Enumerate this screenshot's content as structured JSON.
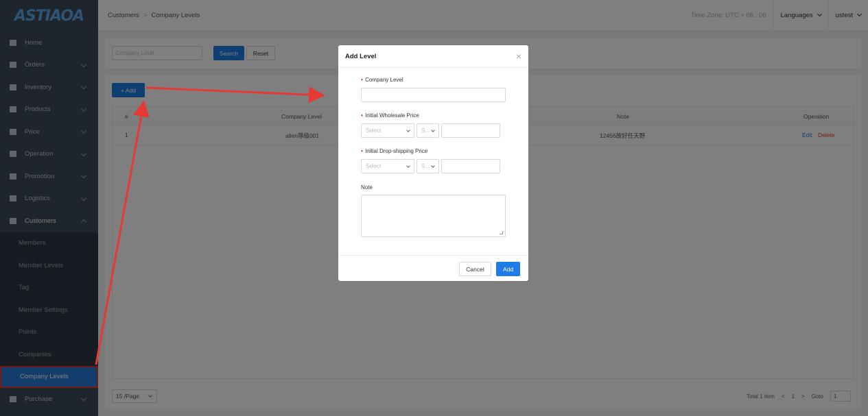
{
  "sidebar": {
    "logo": "ASTIAOA",
    "items": [
      {
        "label": "Home",
        "icon": "home-icon"
      },
      {
        "label": "Orders",
        "icon": "orders-icon"
      },
      {
        "label": "Inventory",
        "icon": "inventory-icon"
      },
      {
        "label": "Products",
        "icon": "products-icon"
      },
      {
        "label": "Price",
        "icon": "price-icon"
      },
      {
        "label": "Operation",
        "icon": "operation-icon"
      },
      {
        "label": "Promotion",
        "icon": "promotion-icon"
      },
      {
        "label": "Logistics",
        "icon": "logistics-icon"
      },
      {
        "label": "Customers",
        "icon": "customers-icon"
      }
    ],
    "sub_items": [
      {
        "label": "Members"
      },
      {
        "label": "Member Levels"
      },
      {
        "label": "Tag"
      },
      {
        "label": "Member Settings"
      },
      {
        "label": "Points"
      },
      {
        "label": "Companies"
      },
      {
        "label": "Company Levels"
      }
    ],
    "purchase": {
      "label": "Purchase",
      "icon": "purchase-icon"
    }
  },
  "header": {
    "breadcrumb": [
      "Customers",
      "Company Levels"
    ],
    "breadcrumb_sep": ">",
    "timezone": "Time Zone: UTC + 06 : 00",
    "languages": "Languages",
    "user": "ustest"
  },
  "filter": {
    "company_level_placeholder": "Company Level",
    "search": "Search",
    "reset": "Reset"
  },
  "table": {
    "add": "+ Add",
    "columns": [
      "#",
      "Company Level",
      "Note",
      "Operation"
    ],
    "rows": [
      {
        "index": "1",
        "level": "allen等级001",
        "note": "12456故好任天野",
        "edit": "Edit",
        "delete": "Delete"
      }
    ]
  },
  "pagination": {
    "page_size": "15 /Page",
    "total": "Total 1 item",
    "prev": "<",
    "current": "1",
    "next": ">",
    "goto_label": "Goto",
    "goto_value": "1"
  },
  "modal": {
    "title": "Add Level",
    "close": "×",
    "fields": {
      "company_level": "Company Level",
      "wholesale": "Initial Wholesale Price",
      "dropship": "Initial Drop-shipping Price",
      "note": "Note"
    },
    "select_placeholder": "Select",
    "sign_placeholder": "S...",
    "cancel": "Cancel",
    "add": "Add"
  },
  "colors": {
    "primary": "#1f7ce6",
    "sidebar_bg": "#3e4a5a",
    "annotation_red": "#e53935"
  }
}
